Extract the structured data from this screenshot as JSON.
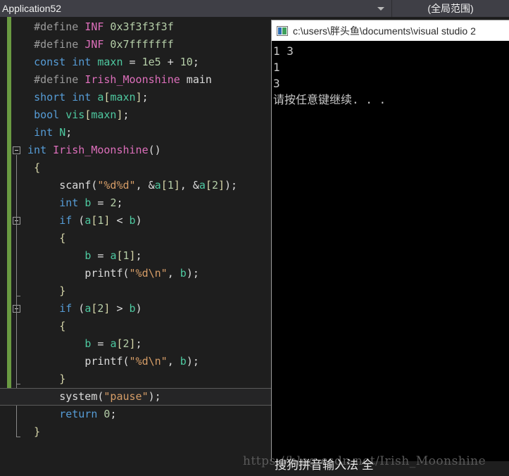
{
  "navbar": {
    "scope_label": "Application52",
    "member_label": "(全局范围)",
    "caret_icon": "chevron-down-icon"
  },
  "editor": {
    "current_line_index": 21,
    "lines": [
      {
        "indent": "  ",
        "tokens": [
          {
            "t": "#define ",
            "c": "t-pre"
          },
          {
            "t": "INF",
            "c": "t-macro"
          },
          {
            "t": " 0x3f3f3f3f",
            "c": "t-num"
          }
        ]
      },
      {
        "indent": "  ",
        "tokens": [
          {
            "t": "#define ",
            "c": "t-pre"
          },
          {
            "t": "JNF",
            "c": "t-macro"
          },
          {
            "t": " 0x7fffffff",
            "c": "t-num"
          }
        ]
      },
      {
        "indent": "  ",
        "tokens": [
          {
            "t": "const",
            "c": "t-kw"
          },
          {
            "t": " ",
            "c": "t-punc"
          },
          {
            "t": "int",
            "c": "t-kw"
          },
          {
            "t": " ",
            "c": "t-punc"
          },
          {
            "t": "maxn",
            "c": "t-var"
          },
          {
            "t": " = ",
            "c": "t-punc"
          },
          {
            "t": "1e5",
            "c": "t-num"
          },
          {
            "t": " + ",
            "c": "t-punc"
          },
          {
            "t": "10",
            "c": "t-num"
          },
          {
            "t": ";",
            "c": "t-punc"
          }
        ]
      },
      {
        "indent": "  ",
        "tokens": [
          {
            "t": "#define ",
            "c": "t-pre"
          },
          {
            "t": "Irish_Moonshine",
            "c": "t-macro"
          },
          {
            "t": " main",
            "c": "t-punc"
          }
        ]
      },
      {
        "indent": "  ",
        "tokens": [
          {
            "t": "short",
            "c": "t-kw"
          },
          {
            "t": " ",
            "c": "t-punc"
          },
          {
            "t": "int",
            "c": "t-kw"
          },
          {
            "t": " ",
            "c": "t-punc"
          },
          {
            "t": "a",
            "c": "t-var"
          },
          {
            "t": "[",
            "c": "t-brace"
          },
          {
            "t": "maxn",
            "c": "t-var"
          },
          {
            "t": "]",
            "c": "t-brace"
          },
          {
            "t": ";",
            "c": "t-punc"
          }
        ]
      },
      {
        "indent": "  ",
        "tokens": [
          {
            "t": "bool",
            "c": "t-kw"
          },
          {
            "t": " ",
            "c": "t-punc"
          },
          {
            "t": "vis",
            "c": "t-var"
          },
          {
            "t": "[",
            "c": "t-brace"
          },
          {
            "t": "maxn",
            "c": "t-var"
          },
          {
            "t": "]",
            "c": "t-brace"
          },
          {
            "t": ";",
            "c": "t-punc"
          }
        ]
      },
      {
        "indent": "  ",
        "tokens": [
          {
            "t": "int",
            "c": "t-kw"
          },
          {
            "t": " ",
            "c": "t-punc"
          },
          {
            "t": "N",
            "c": "t-var"
          },
          {
            "t": ";",
            "c": "t-punc"
          }
        ]
      },
      {
        "indent": " ",
        "tokens": [
          {
            "t": "int",
            "c": "t-kw"
          },
          {
            "t": " ",
            "c": "t-punc"
          },
          {
            "t": "Irish_Moonshine",
            "c": "t-macro"
          },
          {
            "t": "()",
            "c": "t-punc"
          }
        ]
      },
      {
        "indent": "  ",
        "tokens": [
          {
            "t": "{",
            "c": "t-brace"
          }
        ]
      },
      {
        "indent": "      ",
        "tokens": [
          {
            "t": "scanf",
            "c": "t-fn"
          },
          {
            "t": "(",
            "c": "t-punc"
          },
          {
            "t": "\"%d%d\"",
            "c": "t-str"
          },
          {
            "t": ", &",
            "c": "t-punc"
          },
          {
            "t": "a",
            "c": "t-var"
          },
          {
            "t": "[",
            "c": "t-brace"
          },
          {
            "t": "1",
            "c": "t-num"
          },
          {
            "t": "]",
            "c": "t-brace"
          },
          {
            "t": ", &",
            "c": "t-punc"
          },
          {
            "t": "a",
            "c": "t-var"
          },
          {
            "t": "[",
            "c": "t-brace"
          },
          {
            "t": "2",
            "c": "t-num"
          },
          {
            "t": "]",
            "c": "t-brace"
          },
          {
            "t": ");",
            "c": "t-punc"
          }
        ]
      },
      {
        "indent": "      ",
        "tokens": [
          {
            "t": "int",
            "c": "t-kw"
          },
          {
            "t": " ",
            "c": "t-punc"
          },
          {
            "t": "b",
            "c": "t-var"
          },
          {
            "t": " = ",
            "c": "t-punc"
          },
          {
            "t": "2",
            "c": "t-num"
          },
          {
            "t": ";",
            "c": "t-punc"
          }
        ]
      },
      {
        "indent": "      ",
        "tokens": [
          {
            "t": "if",
            "c": "t-kw"
          },
          {
            "t": " (",
            "c": "t-punc"
          },
          {
            "t": "a",
            "c": "t-var"
          },
          {
            "t": "[",
            "c": "t-brace"
          },
          {
            "t": "1",
            "c": "t-num"
          },
          {
            "t": "]",
            "c": "t-brace"
          },
          {
            "t": " < ",
            "c": "t-punc"
          },
          {
            "t": "b",
            "c": "t-var"
          },
          {
            "t": ")",
            "c": "t-punc"
          }
        ]
      },
      {
        "indent": "      ",
        "tokens": [
          {
            "t": "{",
            "c": "t-brace"
          }
        ]
      },
      {
        "indent": "          ",
        "tokens": [
          {
            "t": "b",
            "c": "t-var"
          },
          {
            "t": " = ",
            "c": "t-punc"
          },
          {
            "t": "a",
            "c": "t-var"
          },
          {
            "t": "[",
            "c": "t-brace"
          },
          {
            "t": "1",
            "c": "t-num"
          },
          {
            "t": "]",
            "c": "t-brace"
          },
          {
            "t": ";",
            "c": "t-punc"
          }
        ]
      },
      {
        "indent": "          ",
        "tokens": [
          {
            "t": "printf",
            "c": "t-fn"
          },
          {
            "t": "(",
            "c": "t-punc"
          },
          {
            "t": "\"%d\\n\"",
            "c": "t-str"
          },
          {
            "t": ", ",
            "c": "t-punc"
          },
          {
            "t": "b",
            "c": "t-var"
          },
          {
            "t": ");",
            "c": "t-punc"
          }
        ]
      },
      {
        "indent": "      ",
        "tokens": [
          {
            "t": "}",
            "c": "t-brace"
          }
        ]
      },
      {
        "indent": "      ",
        "tokens": [
          {
            "t": "if",
            "c": "t-kw"
          },
          {
            "t": " (",
            "c": "t-punc"
          },
          {
            "t": "a",
            "c": "t-var"
          },
          {
            "t": "[",
            "c": "t-brace"
          },
          {
            "t": "2",
            "c": "t-num"
          },
          {
            "t": "]",
            "c": "t-brace"
          },
          {
            "t": " > ",
            "c": "t-punc"
          },
          {
            "t": "b",
            "c": "t-var"
          },
          {
            "t": ")",
            "c": "t-punc"
          }
        ]
      },
      {
        "indent": "      ",
        "tokens": [
          {
            "t": "{",
            "c": "t-brace"
          }
        ]
      },
      {
        "indent": "          ",
        "tokens": [
          {
            "t": "b",
            "c": "t-var"
          },
          {
            "t": " = ",
            "c": "t-punc"
          },
          {
            "t": "a",
            "c": "t-var"
          },
          {
            "t": "[",
            "c": "t-brace"
          },
          {
            "t": "2",
            "c": "t-num"
          },
          {
            "t": "]",
            "c": "t-brace"
          },
          {
            "t": ";",
            "c": "t-punc"
          }
        ]
      },
      {
        "indent": "          ",
        "tokens": [
          {
            "t": "printf",
            "c": "t-fn"
          },
          {
            "t": "(",
            "c": "t-punc"
          },
          {
            "t": "\"%d\\n\"",
            "c": "t-str"
          },
          {
            "t": ", ",
            "c": "t-punc"
          },
          {
            "t": "b",
            "c": "t-var"
          },
          {
            "t": ");",
            "c": "t-punc"
          }
        ]
      },
      {
        "indent": "      ",
        "tokens": [
          {
            "t": "}",
            "c": "t-brace"
          }
        ]
      },
      {
        "indent": "      ",
        "tokens": [
          {
            "t": "system",
            "c": "t-fn"
          },
          {
            "t": "(",
            "c": "t-punc"
          },
          {
            "t": "\"pause\"",
            "c": "t-str"
          },
          {
            "t": ");",
            "c": "t-punc"
          }
        ]
      },
      {
        "indent": "      ",
        "tokens": [
          {
            "t": "return",
            "c": "t-kw"
          },
          {
            "t": " ",
            "c": "t-punc"
          },
          {
            "t": "0",
            "c": "t-num"
          },
          {
            "t": ";",
            "c": "t-punc"
          }
        ]
      },
      {
        "indent": "  ",
        "tokens": [
          {
            "t": "}",
            "c": "t-brace"
          }
        ]
      }
    ],
    "fold_boxes": [
      7,
      11,
      16
    ],
    "change_bar_color": "#6a9a42"
  },
  "console": {
    "icon_name": "console-app-icon",
    "title": "c:\\users\\胖头鱼\\documents\\visual studio 2",
    "output_lines": [
      "1 3",
      "1",
      "3",
      "请按任意键继续. . ."
    ]
  },
  "watermarks": {
    "url": "https://blog.csdn.net/Irish_Moonshine",
    "ime": "搜狗拼音输入法 全"
  }
}
